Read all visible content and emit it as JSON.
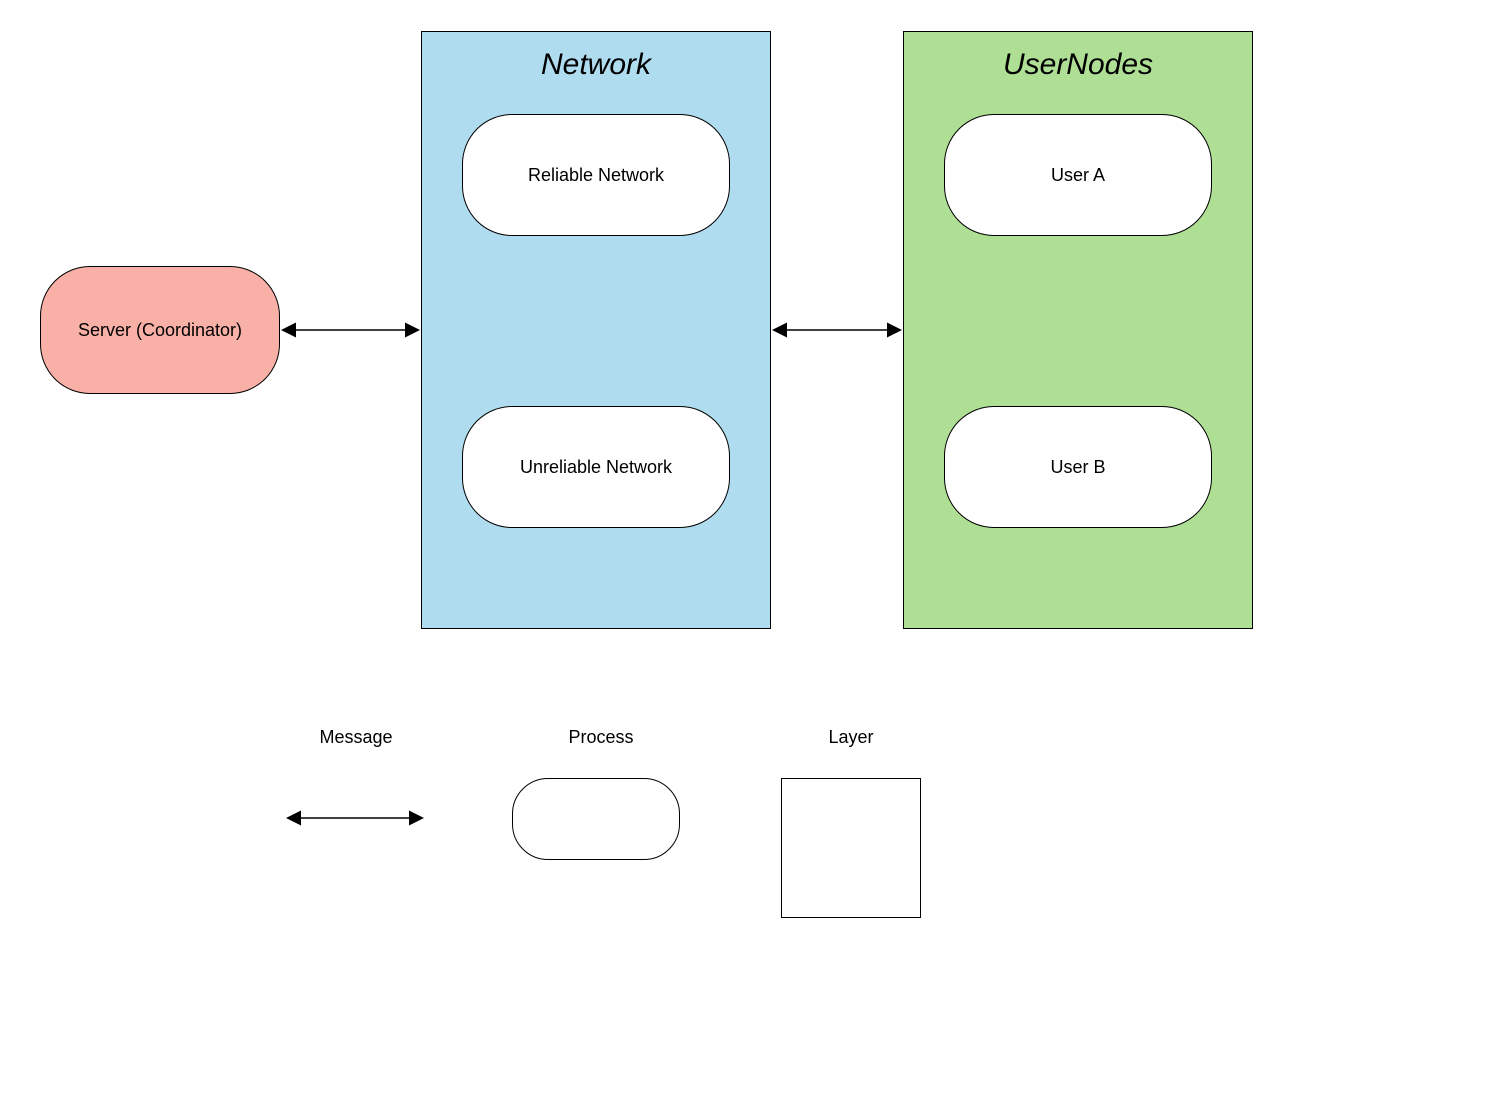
{
  "nodes": {
    "server": "Server (Coordinator)",
    "network_title": "Network",
    "reliable": "Reliable Network",
    "unreliable": "Unreliable Network",
    "usernodes_title": "UserNodes",
    "user_a": "User A",
    "user_b": "User B"
  },
  "legend": {
    "message": "Message",
    "process": "Process",
    "layer": "Layer"
  },
  "colors": {
    "server_fill": "#f8b0a7",
    "network_fill": "#b0dcf0",
    "usernodes_fill": "#afdf95"
  }
}
